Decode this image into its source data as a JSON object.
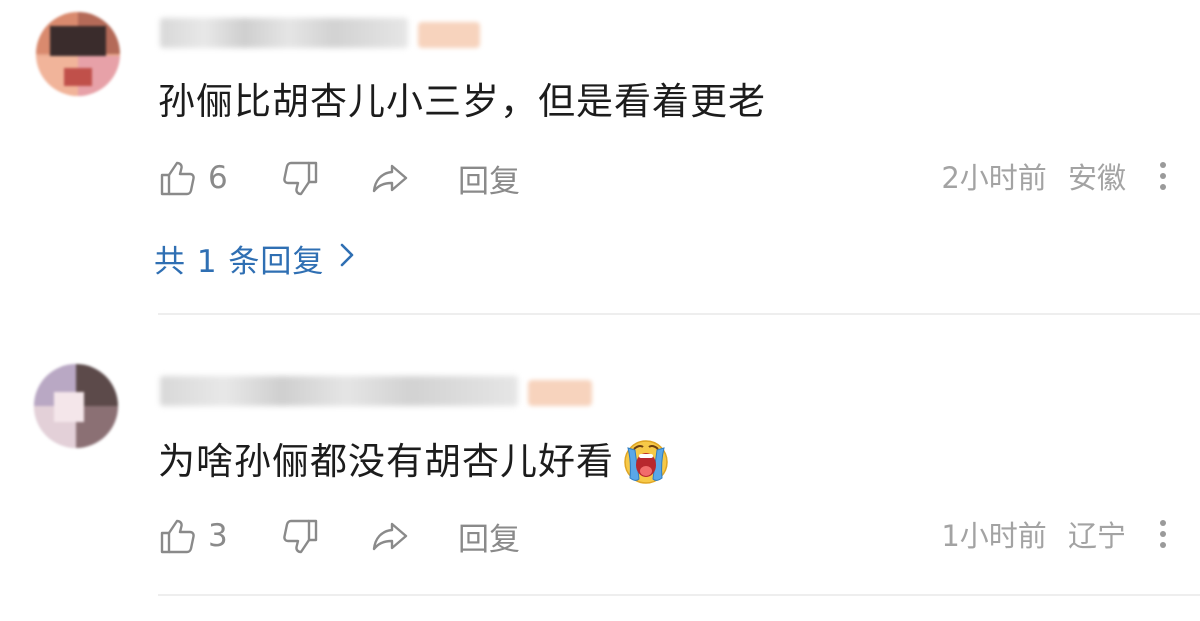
{
  "comments": [
    {
      "text": "孙俪比胡杏儿小三岁，但是看着更老",
      "likes": "6",
      "reply_label": "回复",
      "time": "2小时前",
      "location": "安徽",
      "replies_link": "共 1 条回复",
      "has_emoji": false
    },
    {
      "text": "为啥孙俪都没有胡杏儿好看",
      "likes": "3",
      "reply_label": "回复",
      "time": "1小时前",
      "location": "辽宁",
      "has_emoji": true,
      "emoji_icon": "crying-face-icon"
    }
  ],
  "colors": {
    "link": "#2f6fb3",
    "meta": "#a3a3a3",
    "action": "#888888",
    "divider": "#eeeeee"
  },
  "icons": [
    "thumbs-up-icon",
    "thumbs-down-icon",
    "share-icon",
    "more-vertical-icon",
    "chevron-right-icon",
    "crying-face-icon"
  ]
}
